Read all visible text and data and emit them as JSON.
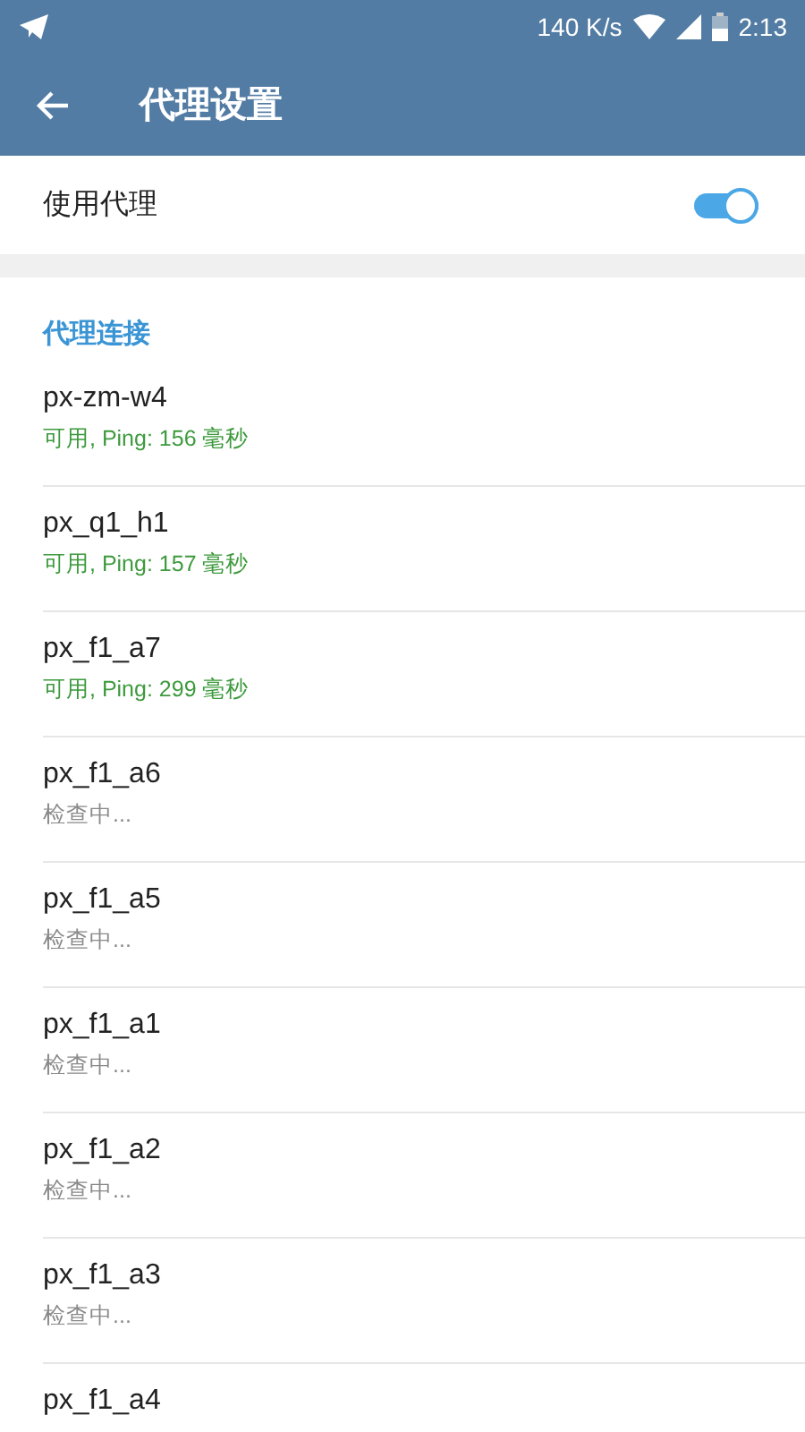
{
  "status_bar": {
    "speed": "140 K/s",
    "time": "2:13"
  },
  "app_bar": {
    "title": "代理设置"
  },
  "use_proxy": {
    "label": "使用代理",
    "on": true
  },
  "section": {
    "title": "代理连接"
  },
  "proxies": [
    {
      "name": "px-zm-w4",
      "status": "可用, Ping: 156 毫秒",
      "kind": "available"
    },
    {
      "name": "px_q1_h1",
      "status": "可用, Ping: 157 毫秒",
      "kind": "available"
    },
    {
      "name": "px_f1_a7",
      "status": "可用, Ping: 299 毫秒",
      "kind": "available"
    },
    {
      "name": "px_f1_a6",
      "status": "检查中...",
      "kind": "checking"
    },
    {
      "name": "px_f1_a5",
      "status": "检查中...",
      "kind": "checking"
    },
    {
      "name": "px_f1_a1",
      "status": "检查中...",
      "kind": "checking"
    },
    {
      "name": "px_f1_a2",
      "status": "检查中...",
      "kind": "checking"
    },
    {
      "name": "px_f1_a3",
      "status": "检查中...",
      "kind": "checking"
    },
    {
      "name": "px_f1_a4"
    }
  ]
}
